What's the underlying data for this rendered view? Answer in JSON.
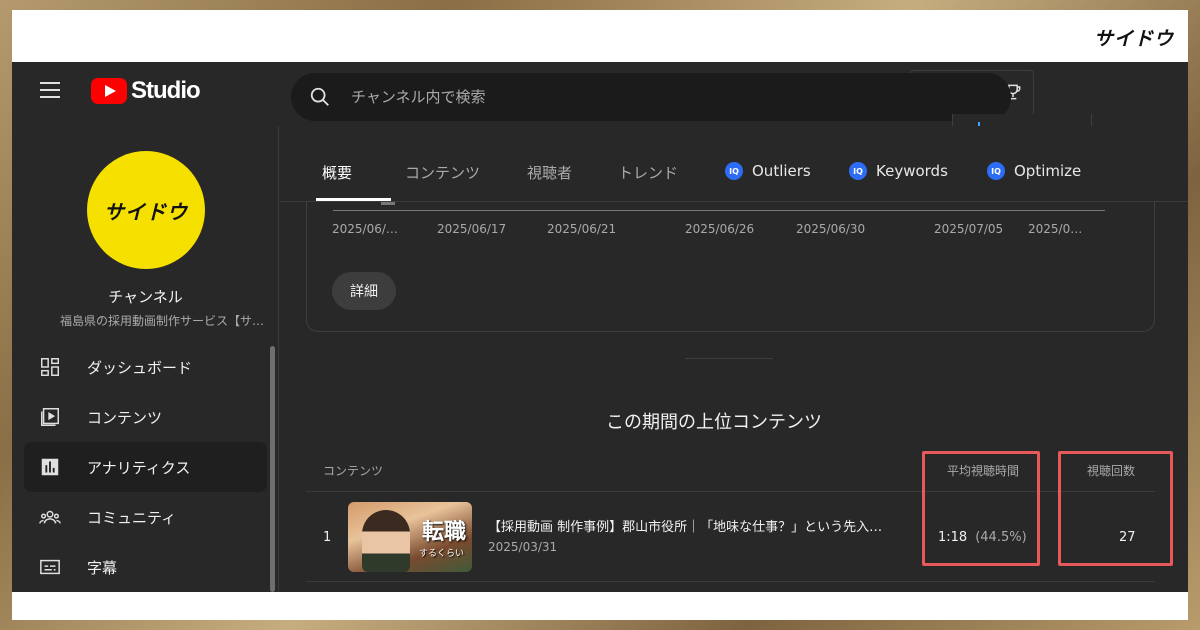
{
  "brand_logo_text": "サイドウ",
  "app": {
    "logo_text": "Studio"
  },
  "search": {
    "placeholder": "チャンネル内で検索"
  },
  "channel": {
    "avatar_text": "サイドウ",
    "title": "チャンネル",
    "description": "福島県の採用動画制作サービス【サ…"
  },
  "sidebar": {
    "items": [
      {
        "label": "ダッシュボード",
        "icon": "dashboard-icon"
      },
      {
        "label": "コンテンツ",
        "icon": "content-icon"
      },
      {
        "label": "アナリティクス",
        "icon": "analytics-icon",
        "active": true
      },
      {
        "label": "コミュニティ",
        "icon": "community-icon"
      },
      {
        "label": "字幕",
        "icon": "subtitles-icon"
      }
    ]
  },
  "tabs": [
    {
      "label": "概要",
      "active": true
    },
    {
      "label": "コンテンツ"
    },
    {
      "label": "視聴者"
    },
    {
      "label": "トレンド"
    },
    {
      "label": "Outliers",
      "badge": "IQ"
    },
    {
      "label": "Keywords",
      "badge": "IQ"
    },
    {
      "label": "Optimize",
      "badge": "IQ"
    }
  ],
  "chart": {
    "dates": [
      "2025/06/…",
      "2025/06/17",
      "2025/06/21",
      "2025/06/26",
      "2025/06/30",
      "2025/07/05",
      "2025/0…"
    ],
    "detail_button": "詳細"
  },
  "top_content": {
    "section_title": "この期間の上位コンテンツ",
    "columns": {
      "content": "コンテンツ",
      "avg_view_time": "平均視聴時間",
      "views": "視聴回数"
    },
    "rows": [
      {
        "rank": "1",
        "title": "【採用動画 制作事例】郡山市役所｜「地味な仕事？」という先入…",
        "date": "2025/03/31",
        "thumb_text": "転職",
        "thumb_sub": "するくらい",
        "avg_time": "1:18",
        "avg_pct": "(44.5%)",
        "views": "27"
      }
    ]
  },
  "colors": {
    "highlight": "#e8595c",
    "accent_red": "#ff0000",
    "iq_blue": "#2d6cf5",
    "avatar_yellow": "#f5e000"
  }
}
